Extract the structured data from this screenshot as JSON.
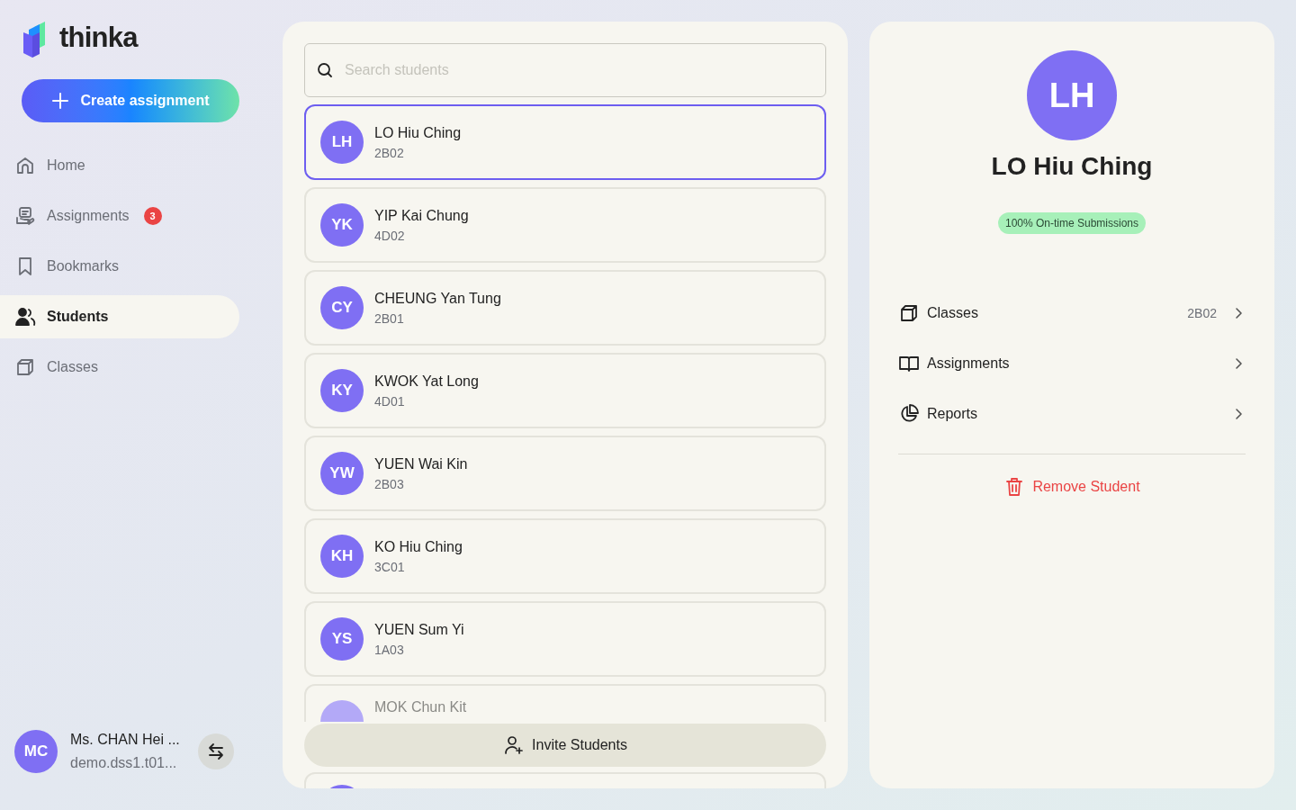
{
  "app": {
    "logo": "thinka"
  },
  "sidebar": {
    "create_button": "Create assignment",
    "items": [
      {
        "label": "Home",
        "selected": false
      },
      {
        "label": "Assignments",
        "selected": false,
        "badge": "3"
      },
      {
        "label": "Bookmarks",
        "selected": false
      },
      {
        "label": "Students",
        "selected": true
      },
      {
        "label": "Classes",
        "selected": false
      }
    ],
    "user": {
      "initials": "MC",
      "name": "Ms. CHAN Hei ...",
      "email": "demo.dss1.t01..."
    }
  },
  "student_list": {
    "search": {
      "placeholder": "Search students"
    },
    "students": [
      {
        "initials": "LH",
        "name": "LO Hiu Ching",
        "class": "2B02",
        "selected": true
      },
      {
        "initials": "YK",
        "name": "YIP Kai Chung",
        "class": "4D02",
        "selected": false
      },
      {
        "initials": "CY",
        "name": "CHEUNG Yan Tung",
        "class": "2B01",
        "selected": false
      },
      {
        "initials": "KY",
        "name": "KWOK Yat Long",
        "class": "4D01",
        "selected": false
      },
      {
        "initials": "YW",
        "name": "YUEN Wai Kin",
        "class": "2B03",
        "selected": false
      },
      {
        "initials": "KH",
        "name": "KO Hiu Ching",
        "class": "3C01",
        "selected": false
      },
      {
        "initials": "YS",
        "name": "YUEN Sum Yi",
        "class": "1A03",
        "selected": false
      },
      {
        "name": "MOK Chun Kit",
        "selected": false
      }
    ],
    "invite_button": "Invite Students"
  },
  "detail": {
    "initials": "LH",
    "name": "LO Hiu Ching",
    "badge": "100% On-time Submissions",
    "menu": [
      {
        "label": "Classes",
        "value": "2B02"
      },
      {
        "label": "Assignments"
      },
      {
        "label": "Reports"
      }
    ],
    "remove_button": "Remove Student"
  }
}
